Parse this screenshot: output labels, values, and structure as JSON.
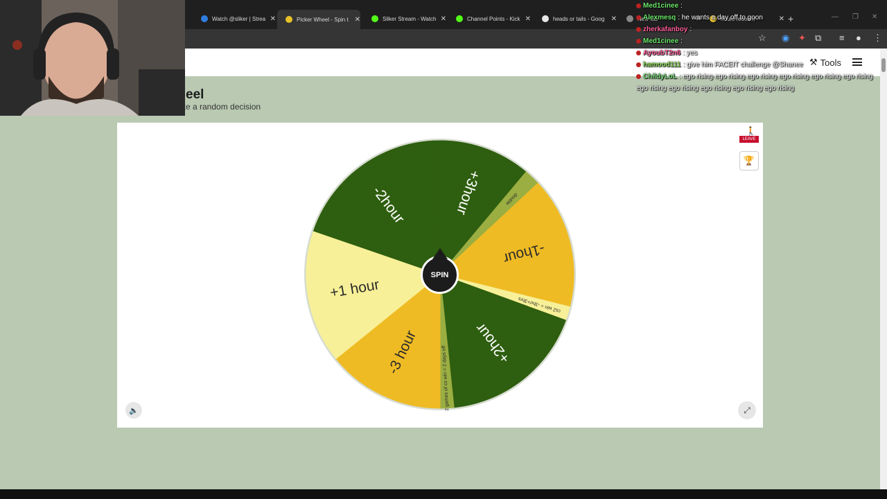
{
  "browser": {
    "tabs": [
      {
        "title": "Watch @sliker | Strea",
        "fav": "#2f7de1"
      },
      {
        "title": "Picker Wheel - Spin t",
        "fav": "#e8c229"
      },
      {
        "title": "Sliker Stream - Watch",
        "fav": "#53fc18"
      },
      {
        "title": "Channel Points - Kick",
        "fav": "#53fc18"
      },
      {
        "title": "heads or tails - Goog",
        "fav": "#e8e8e8"
      },
      {
        "title": "New tab",
        "fav": "#888888"
      },
      {
        "title": "hours redeem",
        "fav": "#e8c229"
      }
    ],
    "active_tab": 1
  },
  "page": {
    "title": "eel",
    "subtitle": "ke a random decision",
    "tools_label": "Tools",
    "leave_label": "LEAVE",
    "spin_label": "SPIN"
  },
  "wheel": {
    "segments": [
      {
        "label": "+3hour",
        "color": "#2e5e0f"
      },
      {
        "label": "double",
        "color": "#9aae42"
      },
      {
        "label": "-1hour",
        "color": "#efbb24"
      },
      {
        "label": "cs2 win = -3hr/+3hrs",
        "color": "#f7f098"
      },
      {
        "label": "+2hour",
        "color": "#2e5e0f"
      },
      {
        "label": "2 games of cs win = 2 days off",
        "color": "#9aae42"
      },
      {
        "label": "-3 hour",
        "color": "#efbb24"
      },
      {
        "label": "+1 hour",
        "color": "#f7f098"
      },
      {
        "label": "-2hour",
        "color": "#2e5e0f"
      }
    ]
  },
  "chat": {
    "messages": [
      {
        "user": "Med1cinee",
        "color": "#6be86b",
        "text": ":"
      },
      {
        "user": "Alexmesq",
        "color": "#6be86b",
        "text": ": he wants a day off to goon"
      },
      {
        "user": "zherkafanboy",
        "color": "#ff5e9a",
        "text": ":"
      },
      {
        "user": "Med1cinee",
        "color": "#6be86b",
        "text": ":"
      },
      {
        "user": "AyoubT2n6",
        "color": "#ff5e9a",
        "text": ": yes"
      },
      {
        "user": "hamood111",
        "color": "#8fdc5a",
        "text": ": give him FACEIT challenge @Shanee"
      },
      {
        "user": "ChildyLoL",
        "color": "#7ee07e",
        "text": ": ego rising ego rising ego rising ego rising ego rising ego rising ego rising ego rising ego rising ego rising ego rising"
      }
    ]
  }
}
